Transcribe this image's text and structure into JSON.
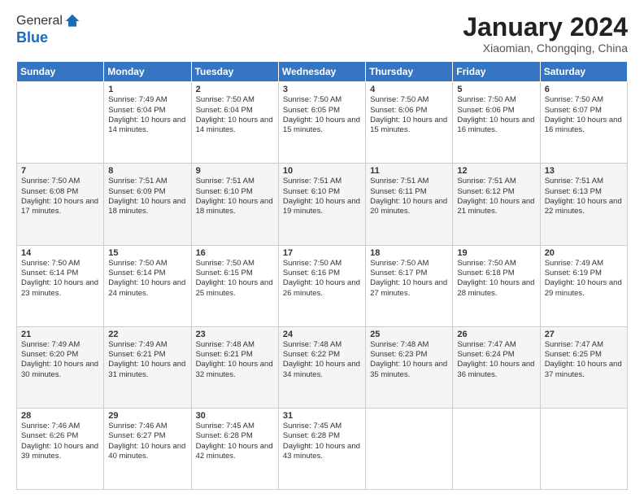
{
  "logo": {
    "line1": "General",
    "line2": "Blue"
  },
  "title": "January 2024",
  "subtitle": "Xiaomian, Chongqing, China",
  "weekdays": [
    "Sunday",
    "Monday",
    "Tuesday",
    "Wednesday",
    "Thursday",
    "Friday",
    "Saturday"
  ],
  "weeks": [
    [
      {
        "day": "",
        "sunrise": "",
        "sunset": "",
        "daylight": ""
      },
      {
        "day": "1",
        "sunrise": "Sunrise: 7:49 AM",
        "sunset": "Sunset: 6:04 PM",
        "daylight": "Daylight: 10 hours and 14 minutes."
      },
      {
        "day": "2",
        "sunrise": "Sunrise: 7:50 AM",
        "sunset": "Sunset: 6:04 PM",
        "daylight": "Daylight: 10 hours and 14 minutes."
      },
      {
        "day": "3",
        "sunrise": "Sunrise: 7:50 AM",
        "sunset": "Sunset: 6:05 PM",
        "daylight": "Daylight: 10 hours and 15 minutes."
      },
      {
        "day": "4",
        "sunrise": "Sunrise: 7:50 AM",
        "sunset": "Sunset: 6:06 PM",
        "daylight": "Daylight: 10 hours and 15 minutes."
      },
      {
        "day": "5",
        "sunrise": "Sunrise: 7:50 AM",
        "sunset": "Sunset: 6:06 PM",
        "daylight": "Daylight: 10 hours and 16 minutes."
      },
      {
        "day": "6",
        "sunrise": "Sunrise: 7:50 AM",
        "sunset": "Sunset: 6:07 PM",
        "daylight": "Daylight: 10 hours and 16 minutes."
      }
    ],
    [
      {
        "day": "7",
        "sunrise": "Sunrise: 7:50 AM",
        "sunset": "Sunset: 6:08 PM",
        "daylight": "Daylight: 10 hours and 17 minutes."
      },
      {
        "day": "8",
        "sunrise": "Sunrise: 7:51 AM",
        "sunset": "Sunset: 6:09 PM",
        "daylight": "Daylight: 10 hours and 18 minutes."
      },
      {
        "day": "9",
        "sunrise": "Sunrise: 7:51 AM",
        "sunset": "Sunset: 6:10 PM",
        "daylight": "Daylight: 10 hours and 18 minutes."
      },
      {
        "day": "10",
        "sunrise": "Sunrise: 7:51 AM",
        "sunset": "Sunset: 6:10 PM",
        "daylight": "Daylight: 10 hours and 19 minutes."
      },
      {
        "day": "11",
        "sunrise": "Sunrise: 7:51 AM",
        "sunset": "Sunset: 6:11 PM",
        "daylight": "Daylight: 10 hours and 20 minutes."
      },
      {
        "day": "12",
        "sunrise": "Sunrise: 7:51 AM",
        "sunset": "Sunset: 6:12 PM",
        "daylight": "Daylight: 10 hours and 21 minutes."
      },
      {
        "day": "13",
        "sunrise": "Sunrise: 7:51 AM",
        "sunset": "Sunset: 6:13 PM",
        "daylight": "Daylight: 10 hours and 22 minutes."
      }
    ],
    [
      {
        "day": "14",
        "sunrise": "Sunrise: 7:50 AM",
        "sunset": "Sunset: 6:14 PM",
        "daylight": "Daylight: 10 hours and 23 minutes."
      },
      {
        "day": "15",
        "sunrise": "Sunrise: 7:50 AM",
        "sunset": "Sunset: 6:14 PM",
        "daylight": "Daylight: 10 hours and 24 minutes."
      },
      {
        "day": "16",
        "sunrise": "Sunrise: 7:50 AM",
        "sunset": "Sunset: 6:15 PM",
        "daylight": "Daylight: 10 hours and 25 minutes."
      },
      {
        "day": "17",
        "sunrise": "Sunrise: 7:50 AM",
        "sunset": "Sunset: 6:16 PM",
        "daylight": "Daylight: 10 hours and 26 minutes."
      },
      {
        "day": "18",
        "sunrise": "Sunrise: 7:50 AM",
        "sunset": "Sunset: 6:17 PM",
        "daylight": "Daylight: 10 hours and 27 minutes."
      },
      {
        "day": "19",
        "sunrise": "Sunrise: 7:50 AM",
        "sunset": "Sunset: 6:18 PM",
        "daylight": "Daylight: 10 hours and 28 minutes."
      },
      {
        "day": "20",
        "sunrise": "Sunrise: 7:49 AM",
        "sunset": "Sunset: 6:19 PM",
        "daylight": "Daylight: 10 hours and 29 minutes."
      }
    ],
    [
      {
        "day": "21",
        "sunrise": "Sunrise: 7:49 AM",
        "sunset": "Sunset: 6:20 PM",
        "daylight": "Daylight: 10 hours and 30 minutes."
      },
      {
        "day": "22",
        "sunrise": "Sunrise: 7:49 AM",
        "sunset": "Sunset: 6:21 PM",
        "daylight": "Daylight: 10 hours and 31 minutes."
      },
      {
        "day": "23",
        "sunrise": "Sunrise: 7:48 AM",
        "sunset": "Sunset: 6:21 PM",
        "daylight": "Daylight: 10 hours and 32 minutes."
      },
      {
        "day": "24",
        "sunrise": "Sunrise: 7:48 AM",
        "sunset": "Sunset: 6:22 PM",
        "daylight": "Daylight: 10 hours and 34 minutes."
      },
      {
        "day": "25",
        "sunrise": "Sunrise: 7:48 AM",
        "sunset": "Sunset: 6:23 PM",
        "daylight": "Daylight: 10 hours and 35 minutes."
      },
      {
        "day": "26",
        "sunrise": "Sunrise: 7:47 AM",
        "sunset": "Sunset: 6:24 PM",
        "daylight": "Daylight: 10 hours and 36 minutes."
      },
      {
        "day": "27",
        "sunrise": "Sunrise: 7:47 AM",
        "sunset": "Sunset: 6:25 PM",
        "daylight": "Daylight: 10 hours and 37 minutes."
      }
    ],
    [
      {
        "day": "28",
        "sunrise": "Sunrise: 7:46 AM",
        "sunset": "Sunset: 6:26 PM",
        "daylight": "Daylight: 10 hours and 39 minutes."
      },
      {
        "day": "29",
        "sunrise": "Sunrise: 7:46 AM",
        "sunset": "Sunset: 6:27 PM",
        "daylight": "Daylight: 10 hours and 40 minutes."
      },
      {
        "day": "30",
        "sunrise": "Sunrise: 7:45 AM",
        "sunset": "Sunset: 6:28 PM",
        "daylight": "Daylight: 10 hours and 42 minutes."
      },
      {
        "day": "31",
        "sunrise": "Sunrise: 7:45 AM",
        "sunset": "Sunset: 6:28 PM",
        "daylight": "Daylight: 10 hours and 43 minutes."
      },
      {
        "day": "",
        "sunrise": "",
        "sunset": "",
        "daylight": ""
      },
      {
        "day": "",
        "sunrise": "",
        "sunset": "",
        "daylight": ""
      },
      {
        "day": "",
        "sunrise": "",
        "sunset": "",
        "daylight": ""
      }
    ]
  ]
}
